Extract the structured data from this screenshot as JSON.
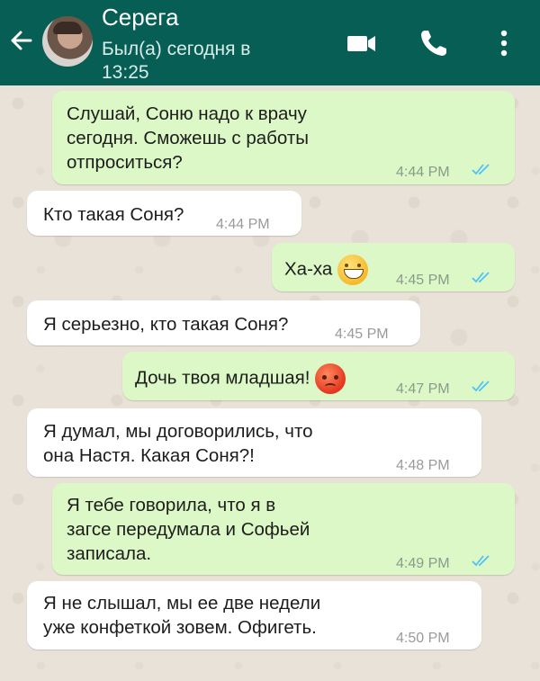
{
  "header": {
    "contact_name": "Серега",
    "status": "Был(а) сегодня в 13:25",
    "background": "#075e54",
    "icons": [
      "back-arrow-icon",
      "video-call-icon",
      "phone-icon",
      "more-vert-icon"
    ]
  },
  "messages": [
    {
      "dir": "out",
      "text": "Слушай, Соню надо к врачу\nсегодня. Сможешь с работы\nотпроситься?",
      "time": "4:44 PM",
      "read": true
    },
    {
      "dir": "in",
      "text": "Кто такая Соня?",
      "time": "4:44 PM"
    },
    {
      "dir": "out",
      "text": "Ха-ха",
      "emoji": "grinning-face",
      "time": "4:45 PM",
      "read": true
    },
    {
      "dir": "in",
      "text": "Я серьезно, кто такая Соня?",
      "time": "4:45 PM"
    },
    {
      "dir": "out",
      "text": "Дочь твоя младшая!",
      "emoji": "angry-face",
      "time": "4:47 PM",
      "read": true
    },
    {
      "dir": "in",
      "text": "Я думал, мы договорились, что\nона Настя. Какая Соня?!",
      "time": "4:48 PM"
    },
    {
      "dir": "out",
      "text": "Я тебе говорила, что я в\nзагсе передумала и Софьей\nзаписала.",
      "time": "4:49 PM",
      "read": true
    },
    {
      "dir": "in",
      "text": "Я не слышал, мы ее две недели\nуже конфеткой зовем. Офигеть.",
      "time": "4:50 PM"
    }
  ],
  "colors": {
    "outgoing": "#dcf8c6",
    "incoming": "#ffffff",
    "read_ticks": "#4fc3f7"
  }
}
